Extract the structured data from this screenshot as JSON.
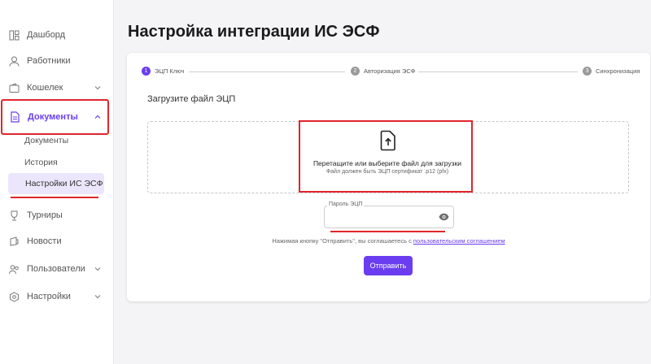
{
  "sidebar": {
    "items": [
      {
        "label": "Дашборд",
        "icon": "dashboard-icon"
      },
      {
        "label": "Работники",
        "icon": "users-icon"
      },
      {
        "label": "Кошелек",
        "icon": "wallet-icon"
      },
      {
        "label": "Документы",
        "icon": "document-icon"
      },
      {
        "label": "Турниры",
        "icon": "trophy-icon"
      },
      {
        "label": "Новости",
        "icon": "news-icon"
      },
      {
        "label": "Пользователи",
        "icon": "group-icon"
      },
      {
        "label": "Настройки",
        "icon": "settings-icon"
      }
    ],
    "sub_items": [
      "Документы",
      "История",
      "Настройки ИС ЭСФ"
    ]
  },
  "page": {
    "title": "Настройка интеграции ИС ЭСФ"
  },
  "stepper": [
    {
      "num": "1",
      "label": "ЭЦП Ключ",
      "active": true
    },
    {
      "num": "2",
      "label": "Авторизация ЭСФ",
      "active": false
    },
    {
      "num": "3",
      "label": "Синхронизация",
      "active": false
    }
  ],
  "upload": {
    "label": "Загрузите файл ЭЦП",
    "title": "Перетащите или выберите файл для загрузки",
    "hint": "Файл должен быть ЭЦП сертификат .p12 (pfx)"
  },
  "password": {
    "label": "Пароль ЭЦП",
    "value": ""
  },
  "agreement": {
    "text": "Нажимая кнопку \"Отправить\", вы соглашаетесь с ",
    "link": "пользовательским соглашением"
  },
  "submit_label": "Отправить",
  "colors": {
    "accent": "#6a3df0",
    "highlight": "#e0262b"
  }
}
